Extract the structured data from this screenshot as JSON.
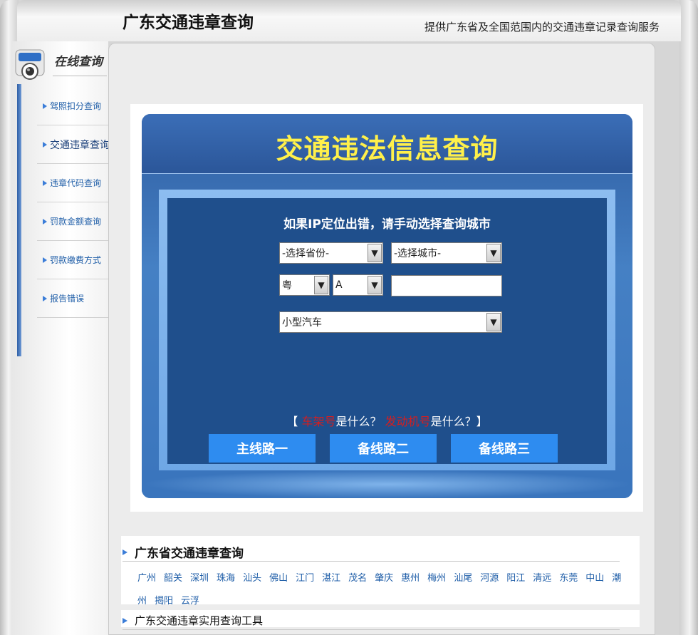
{
  "header": {
    "title": "广东交通违章查询",
    "subtitle": "提供广东省及全国范围内的交通违章记录查询服务"
  },
  "sidebar": {
    "label": "在线查询",
    "items": [
      {
        "label": "驾照扣分查询"
      },
      {
        "label": "交通违章查询"
      },
      {
        "label": "违章代码查询"
      },
      {
        "label": "罚款金额查询"
      },
      {
        "label": "罚款缴费方式"
      },
      {
        "label": "报告错误"
      }
    ]
  },
  "query": {
    "title": "交通违法信息查询",
    "tip": "如果IP定位出错，请手动选择查询城市",
    "province_select": "-选择省份-",
    "city_select": "-选择城市-",
    "plate_prefix": "粤",
    "plate_letter": "A",
    "plate_number": "",
    "vehicle_type": "小型汽车",
    "help": {
      "open": "【",
      "term1": "车架号",
      "q1": "是什么？",
      "term2": "发动机号",
      "q2": "是什么？】"
    },
    "buttons": [
      "主线路一",
      "备线路二",
      "备线路三"
    ]
  },
  "section_cities": {
    "title": "广东省交通违章查询",
    "cities": [
      "广州",
      "韶关",
      "深圳",
      "珠海",
      "汕头",
      "佛山",
      "江门",
      "湛江",
      "茂名",
      "肇庆",
      "惠州",
      "梅州",
      "汕尾",
      "河源",
      "阳江",
      "清远",
      "东莞",
      "中山",
      "潮州",
      "揭阳",
      "云浮"
    ]
  },
  "section_tools": {
    "title": "广东交通违章实用查询工具"
  },
  "colors": {
    "accent": "#2e8cf0",
    "title_yellow": "#fff04a",
    "link_blue": "#1f5ea8",
    "highlight_red": "#d81d1d",
    "panel_blue": "#1f4f8c"
  }
}
